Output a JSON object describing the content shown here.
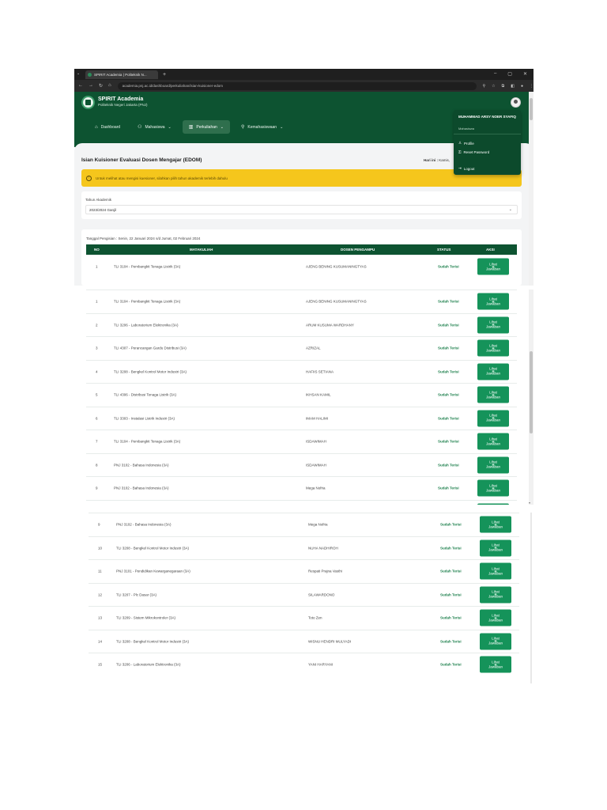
{
  "browser": {
    "tab_title": "SPIRIT Academia | Politeknik N...",
    "tab_close": "×",
    "new_tab": "+",
    "url": "academia.pnj.ac.id/dashboard/perkuliahan/isian-kuisioner-edom"
  },
  "app": {
    "title": "SPIRIT Academia",
    "subtitle": "Politeknik Negeri Jakarta (PNJ)"
  },
  "nav": [
    {
      "label": "Dashboard",
      "icon": "home-icon"
    },
    {
      "label": "Mahasiswa",
      "icon": "users-icon",
      "chevron": "⌄"
    },
    {
      "label": "Perkuliahan",
      "icon": "book-icon",
      "chevron": "⌄",
      "active": true
    },
    {
      "label": "Kemahasiswaan",
      "icon": "person-add-icon",
      "chevron": "⌄"
    }
  ],
  "user_menu": {
    "name": "MUHAMMAD ARSY NOER SYAFIQ",
    "role": "Mahasiswa",
    "items": [
      {
        "label": "Profile",
        "icon": "user-icon"
      },
      {
        "label": "Reset Password",
        "icon": "lock-icon"
      },
      {
        "label": "Logout",
        "icon": "logout-icon"
      }
    ]
  },
  "page": {
    "title": "Isian Kuisioner Evaluasi Dosen Mengajar (EDOM)",
    "hari_label": "Hari ini :",
    "hari_value": "Kamis,"
  },
  "alert": {
    "text": "Untuk melihat atau mengisi kuesioner, silahkan pilih tahun akademik terlebih dahulu"
  },
  "tahun": {
    "label": "Tahun Akademik",
    "value": "2023/2024 Ganjil"
  },
  "periode": "Tanggal Pengisian : Senin, 22 Januari 2024 s/d Jumat, 02 Februari 2024",
  "table": {
    "headers": [
      "NO",
      "MATAKULIAH",
      "DOSEN PENGAMPU",
      "STATUS",
      "AKSI"
    ],
    "action_label_1": "Lihat",
    "action_label_2": "Jawaban",
    "rows": [
      {
        "no": "1",
        "mk": "TLI 3104 - Pembangkit Tenaga Listrik (3A)",
        "dosen": "AJENG BENING KUSUMANINGTYAS",
        "status": "Sudah Terisi"
      },
      {
        "no": "2",
        "mk": "TLI 3206 - Laboratorium Elektronika (3A)",
        "dosen": "ARUM KUSUMA WARDHANY",
        "status": "Sudah Terisi"
      },
      {
        "no": "3",
        "mk": "TLI 4307 - Perancangan Gardu Distribusi (3A)",
        "dosen": "AZRIZAL",
        "status": "Sudah Terisi"
      },
      {
        "no": "4",
        "mk": "TLI 3208 - Bengkel Kontrol Motor Industri (3A)",
        "dosen": "HAFIIS SETIANA",
        "status": "Sudah Terisi"
      },
      {
        "no": "5",
        "mk": "TLI 4306 - Distribusi Tenaga Listrik (3A)",
        "dosen": "IKHSAN KAMIL",
        "status": "Sudah Terisi"
      },
      {
        "no": "6",
        "mk": "TLI 3303 - Instalasi Listrik Industri (3A)",
        "dosen": "IMAM HALIMI",
        "status": "Sudah Terisi"
      },
      {
        "no": "7",
        "mk": "TLI 3104 - Pembangkit Tenaga Listrik (3A)",
        "dosen": "ISDAWIMAH",
        "status": "Sudah Terisi"
      },
      {
        "no": "8",
        "mk": "PNJ 3102 - Bahasa Indonesia (3A)",
        "dosen": "ISDAWIMAH",
        "status": "Sudah Terisi"
      },
      {
        "no": "9",
        "mk": "PNJ 3102 - Bahasa Indonesia (3A)",
        "dosen": "Mega Nofria",
        "status": "Sudah Terisi"
      },
      {
        "no": "10",
        "mk": "TLI 3208 - Bengkel Kontrol Motor Industri (3A)",
        "dosen": "NUHA NADHIROH",
        "status": "Sudah Terisi"
      },
      {
        "no": "11",
        "mk": "PNJ 3101 - Pendidikan Kewarganegaraan (3A)",
        "dosen": "Respati Prajna Vasthi",
        "status": "Sudah Terisi"
      },
      {
        "no": "12",
        "mk": "TLI 3207 - Plc Dasar (3A)",
        "dosen": "SILAWARDONO",
        "status": "Sudah Terisi"
      },
      {
        "no": "13",
        "mk": "TLI 3209 - Sistem Mikrokontroler (3A)",
        "dosen": "Toto Zen",
        "status": "Sudah Terisi"
      },
      {
        "no": "14",
        "mk": "TLI 3208 - Bengkel Kontrol Motor Industri (3A)",
        "dosen": "WISNU HENDRI MULYADI",
        "status": "Sudah Terisi"
      },
      {
        "no": "15",
        "mk": "TLI 3206 - Laboratorium Elektronika (3A)",
        "dosen": "YANI HARYANI",
        "status": "Sudah Terisi"
      }
    ]
  },
  "colors": {
    "primary": "#0d5331",
    "accent": "#15935a",
    "status": "#1a7e4a",
    "alert": "#f5c61c"
  }
}
